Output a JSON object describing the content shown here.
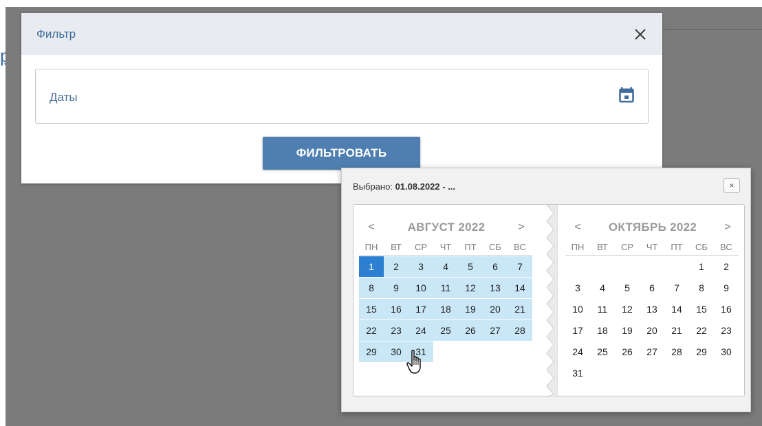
{
  "background": {
    "heading_fragment": "ре"
  },
  "modal": {
    "title": "Фильтр",
    "close_icon": "close-icon",
    "date_field": {
      "label": "Даты",
      "icon": "calendar-icon"
    },
    "filter_button_label": "ФИЛЬТРОВАТЬ"
  },
  "picker": {
    "selected_prefix": "Выбрано:",
    "selected_value": "01.08.2022 - ...",
    "close_label": "×",
    "weekdays": [
      "ПН",
      "ВТ",
      "СР",
      "ЧТ",
      "ПТ",
      "СБ",
      "ВС"
    ],
    "left_month": {
      "prev": "<",
      "name": "АВГУСТ 2022",
      "next": ">"
    },
    "right_month": {
      "prev": "<",
      "name": "ОКТЯБРЬ 2022",
      "next": ">"
    }
  },
  "colors": {
    "accent": "#4f7fb0",
    "range": "#c9e7f7",
    "selected": "#2d7fd2",
    "overlay": "#7b7b7b"
  }
}
